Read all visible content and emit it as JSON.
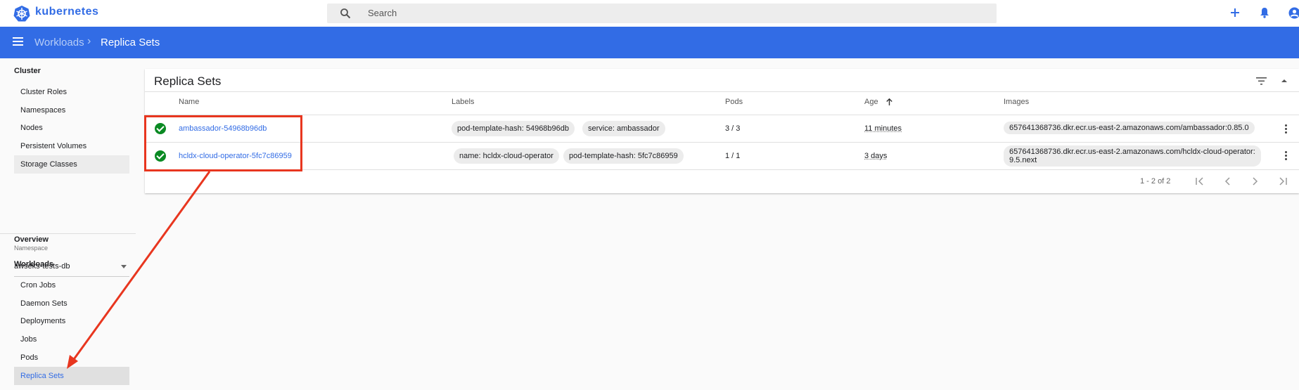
{
  "app": {
    "brand": "kubernetes"
  },
  "search": {
    "placeholder": "Search"
  },
  "breadcrumb": {
    "parent": "Workloads",
    "current": "Replica Sets",
    "separator": "›"
  },
  "sidebar": {
    "cluster_heading": "Cluster",
    "cluster_items": [
      "Cluster Roles",
      "Namespaces",
      "Nodes",
      "Persistent Volumes",
      "Storage Classes"
    ],
    "namespace_label": "Namespace",
    "namespace_value": "awseks-tests-db",
    "overview": "Overview",
    "workloads_heading": "Workloads",
    "workload_items": [
      "Cron Jobs",
      "Daemon Sets",
      "Deployments",
      "Jobs",
      "Pods",
      "Replica Sets"
    ]
  },
  "card": {
    "title": "Replica Sets",
    "columns": {
      "name": "Name",
      "labels": "Labels",
      "pods": "Pods",
      "age": "Age",
      "images": "Images"
    },
    "rows": [
      {
        "name": "ambassador-54968b96db",
        "labels": [
          "pod-template-hash: 54968b96db",
          "service: ambassador"
        ],
        "pods": "3 / 3",
        "age": "11 minutes",
        "image": "657641368736.dkr.ecr.us-east-2.amazonaws.com/ambassador:0.85.0"
      },
      {
        "name": "hcldx-cloud-operator-5fc7c86959",
        "labels": [
          "name: hcldx-cloud-operator",
          "pod-template-hash: 5fc7c86959"
        ],
        "pods": "1 / 1",
        "age": "3 days",
        "image_line1": "657641368736.dkr.ecr.us-east-2.amazonaws.com/hcldx-cloud-operator:",
        "image_line2": "9.5.next"
      }
    ],
    "pagination": "1 - 2 of 2"
  },
  "colors": {
    "primary": "#326ce5",
    "status_ok": "#0a8a23",
    "annotation": "#e8361f"
  },
  "icons": [
    "kubernetes-logo-icon",
    "search-icon",
    "add-icon",
    "notifications-icon",
    "account-icon",
    "menu-icon",
    "filter-icon",
    "collapse-icon",
    "sort-arrow-up-icon",
    "kebab-menu-icon",
    "first-page-icon",
    "previous-page-icon",
    "next-page-icon",
    "last-page-icon"
  ]
}
